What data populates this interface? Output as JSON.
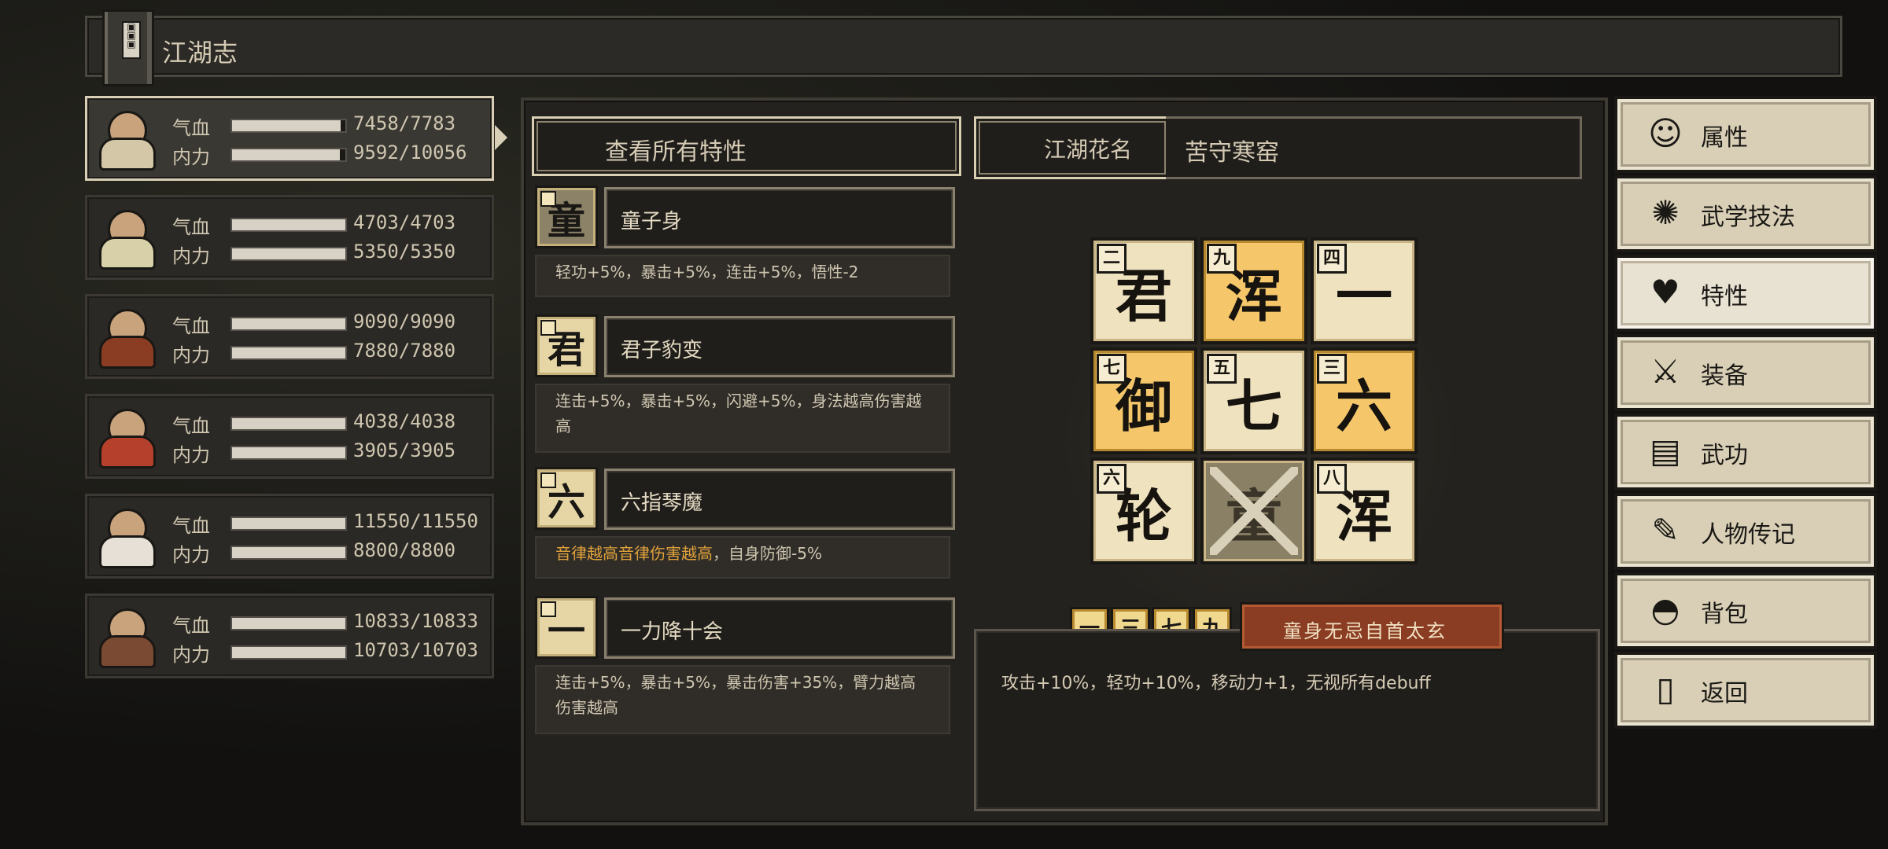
{
  "header": {
    "title": "江湖志"
  },
  "characters": [
    {
      "hp_label": "气血",
      "hp": "7458/7783",
      "hp_fill": 0.96,
      "mp_label": "内力",
      "mp": "9592/10056",
      "mp_fill": 0.95,
      "active": true,
      "color": "#d4c7a8"
    },
    {
      "hp_label": "气血",
      "hp": "4703/4703",
      "hp_fill": 1.0,
      "mp_label": "内力",
      "mp": "5350/5350",
      "mp_fill": 1.0,
      "active": false,
      "color": "#d8d0a8"
    },
    {
      "hp_label": "气血",
      "hp": "9090/9090",
      "hp_fill": 1.0,
      "mp_label": "内力",
      "mp": "7880/7880",
      "mp_fill": 1.0,
      "active": false,
      "color": "#8a3d23"
    },
    {
      "hp_label": "气血",
      "hp": "4038/4038",
      "hp_fill": 1.0,
      "mp_label": "内力",
      "mp": "3905/3905",
      "mp_fill": 1.0,
      "active": false,
      "color": "#b5412c"
    },
    {
      "hp_label": "气血",
      "hp": "11550/11550",
      "hp_fill": 1.0,
      "mp_label": "内力",
      "mp": "8800/8800",
      "mp_fill": 1.0,
      "active": false,
      "color": "#e6e0d6"
    },
    {
      "hp_label": "气血",
      "hp": "10833/10833",
      "hp_fill": 1.0,
      "mp_label": "内力",
      "mp": "10703/10703",
      "mp_fill": 1.0,
      "active": false,
      "color": "#7b4a32"
    }
  ],
  "traits_panel": {
    "view_all_label": "查看所有特性",
    "traits": [
      {
        "icon": "童",
        "locked": true,
        "name": "童子身",
        "desc": "轻功+5%，暴击+5%，连击+5%，悟性-2",
        "desc_orange": ""
      },
      {
        "icon": "君",
        "locked": false,
        "name": "君子豹变",
        "desc": "连击+5%，暴击+5%，闪避+5%，身法越高伤害越高",
        "desc_orange": ""
      },
      {
        "icon": "六",
        "locked": false,
        "name": "六指琴魔",
        "desc_orange": "音律越高音律伤害越高",
        "desc": "，自身防御-5%"
      },
      {
        "icon": "一",
        "locked": false,
        "name": "一力降十会",
        "desc": "连击+5%，暴击+5%，暴击伤害+35%，臂力越高伤害越高",
        "desc_orange": ""
      }
    ]
  },
  "nickname": {
    "label": "江湖花名",
    "value": "苦守寒窑"
  },
  "grid": [
    {
      "char": "君",
      "num": "二",
      "style": "normal"
    },
    {
      "char": "浑",
      "num": "九",
      "style": "hl"
    },
    {
      "char": "一",
      "num": "四",
      "style": "normal"
    },
    {
      "char": "御",
      "num": "七",
      "style": "hl"
    },
    {
      "char": "七",
      "num": "五",
      "style": "normal"
    },
    {
      "char": "六",
      "num": "三",
      "style": "hl"
    },
    {
      "char": "轮",
      "num": "六",
      "style": "normal"
    },
    {
      "char": "童",
      "num": "",
      "style": "locked"
    },
    {
      "char": "浑",
      "num": "八",
      "style": "normal"
    }
  ],
  "combo": {
    "chips": [
      "一",
      "三",
      "七",
      "九"
    ],
    "name": "童身无忌自首太玄",
    "desc": "攻击+10%，轻功+10%，移动力+1，无视所有debuff"
  },
  "menu": [
    {
      "label": "属性",
      "icon": "person-icon",
      "glyph": "☺",
      "active": false
    },
    {
      "label": "武学技法",
      "icon": "martial-skill-icon",
      "glyph": "✺",
      "active": false
    },
    {
      "label": "特性",
      "icon": "trait-heart-icon",
      "glyph": "♥",
      "active": true
    },
    {
      "label": "装备",
      "icon": "sword-icon",
      "glyph": "⚔",
      "active": false
    },
    {
      "label": "武功",
      "icon": "scroll-book-icon",
      "glyph": "▤",
      "active": false
    },
    {
      "label": "人物传记",
      "icon": "biography-icon",
      "glyph": "✎",
      "active": false
    },
    {
      "label": "背包",
      "icon": "bag-icon",
      "glyph": "◓",
      "active": false
    },
    {
      "label": "返回",
      "icon": "door-icon",
      "glyph": "▯",
      "active": false
    }
  ]
}
